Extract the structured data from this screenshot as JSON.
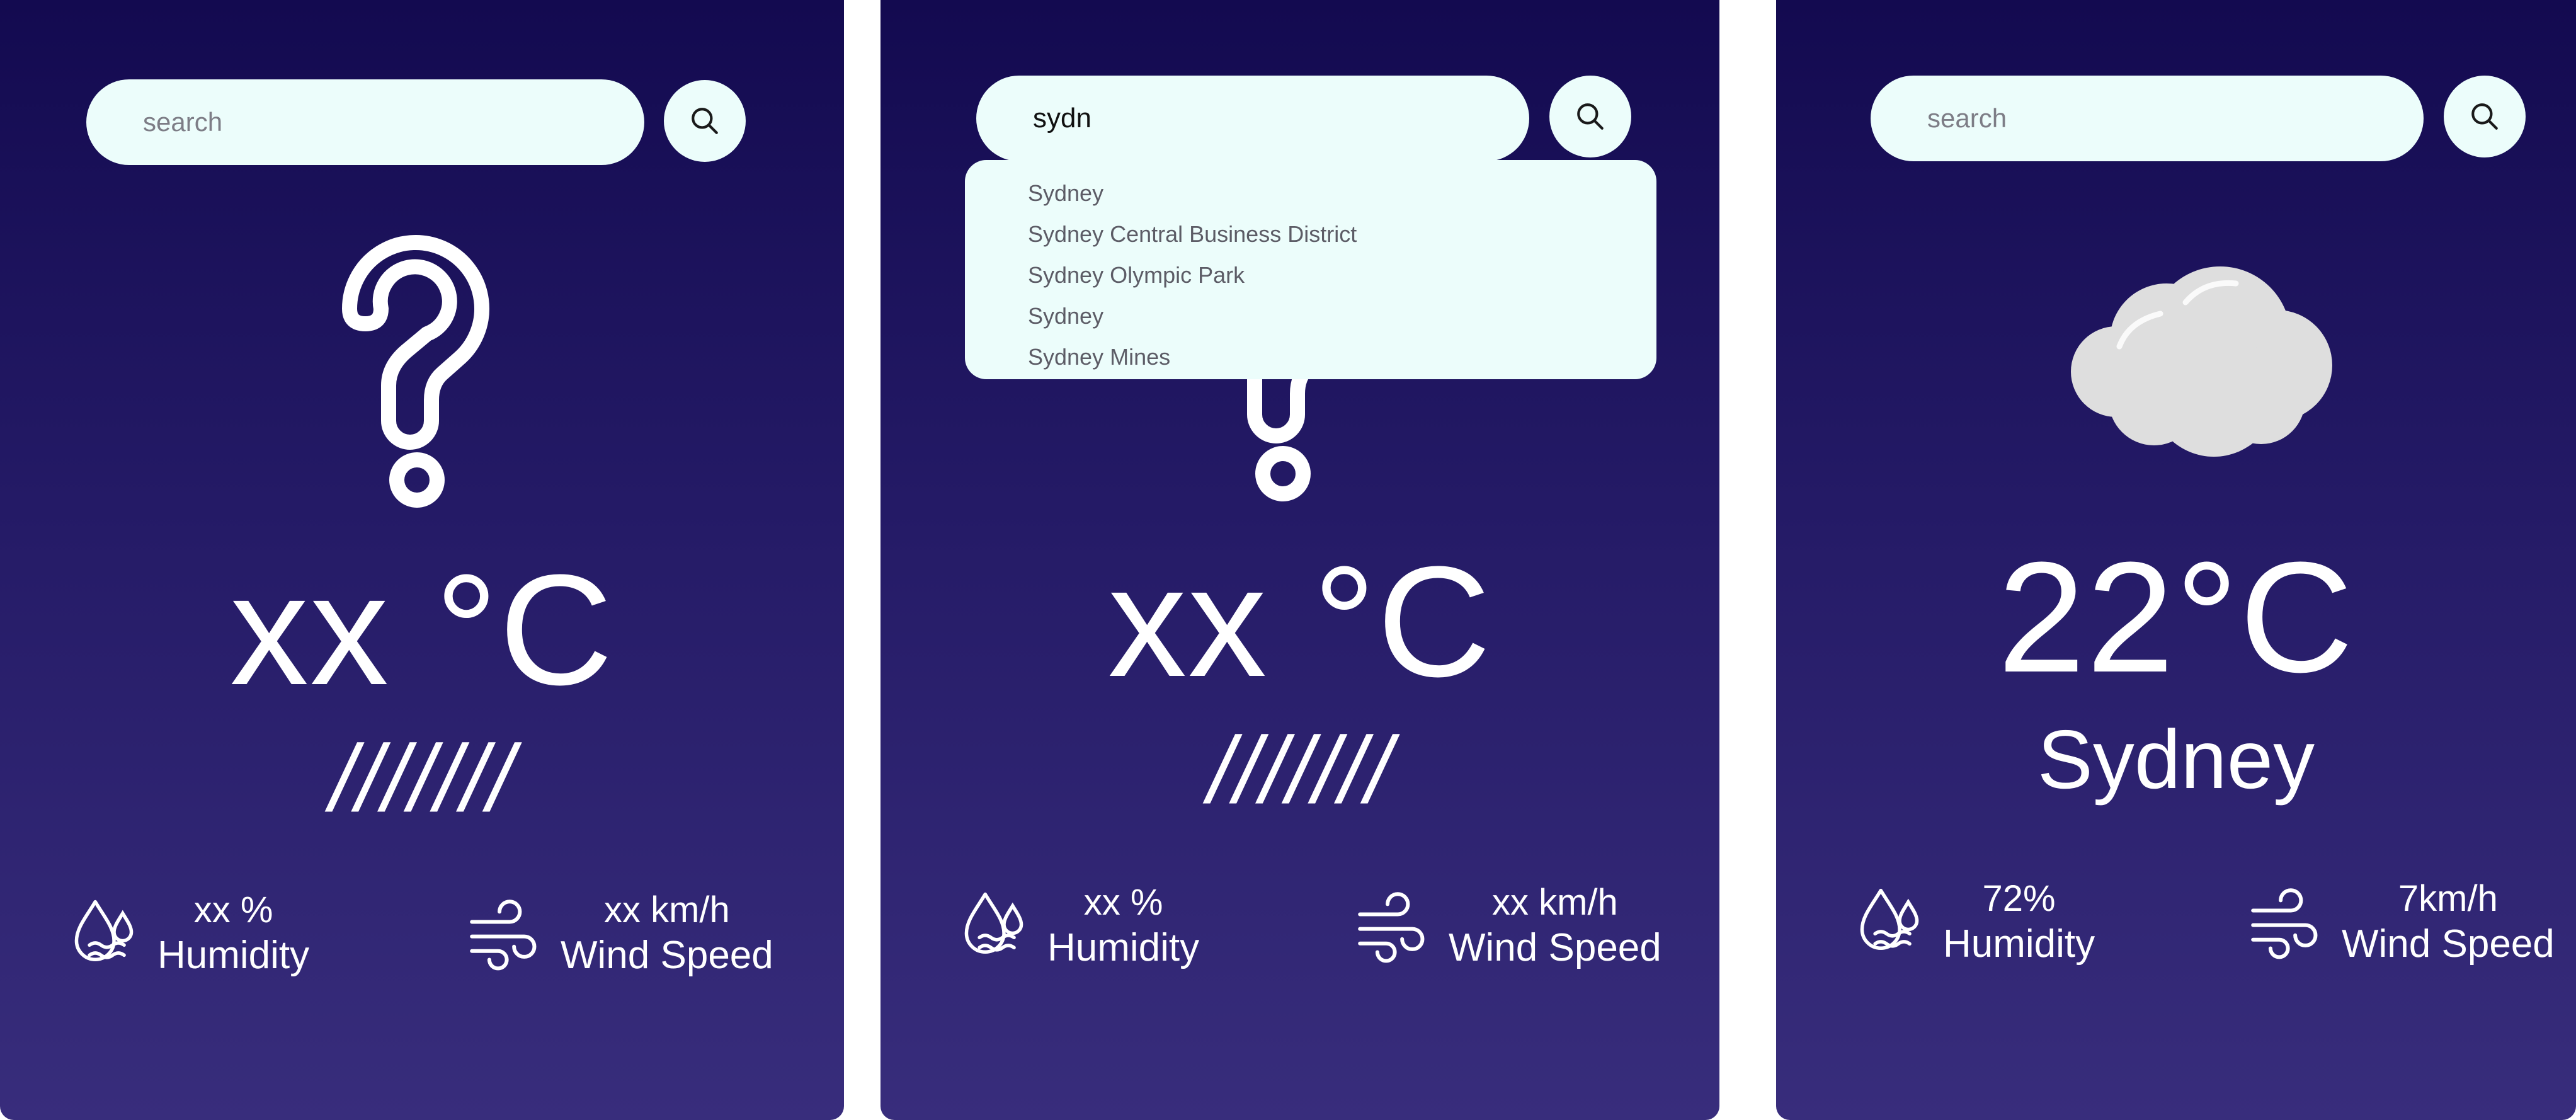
{
  "panels": [
    {
      "search": {
        "placeholder": "search",
        "value": ""
      },
      "icon": "question-mark-icon",
      "temperature": "xx °C",
      "description": "///////",
      "humidity": {
        "value": "xx %",
        "label": "Humidity"
      },
      "wind": {
        "value": "xx km/h",
        "label": "Wind Speed"
      }
    },
    {
      "search": {
        "placeholder": "search",
        "value": "sydn"
      },
      "suggestions": [
        "Sydney",
        "Sydney Central Business District",
        "Sydney Olympic Park",
        "Sydney",
        "Sydney Mines"
      ],
      "icon": "question-mark-icon",
      "temperature": "xx °C",
      "description": "///////",
      "humidity": {
        "value": "xx %",
        "label": "Humidity"
      },
      "wind": {
        "value": "xx km/h",
        "label": "Wind Speed"
      }
    },
    {
      "search": {
        "placeholder": "search",
        "value": ""
      },
      "icon": "cloud-icon",
      "temperature": "22°C",
      "city": "Sydney",
      "humidity": {
        "value": "72%",
        "label": "Humidity"
      },
      "wind": {
        "value": "7km/h",
        "label": "Wind Speed"
      }
    }
  ],
  "colors": {
    "panel_top": "#130a50",
    "panel_bottom": "#382d7c",
    "search_bg": "#ecfdfb",
    "text": "#ffffff",
    "cloud": "#dedede"
  }
}
